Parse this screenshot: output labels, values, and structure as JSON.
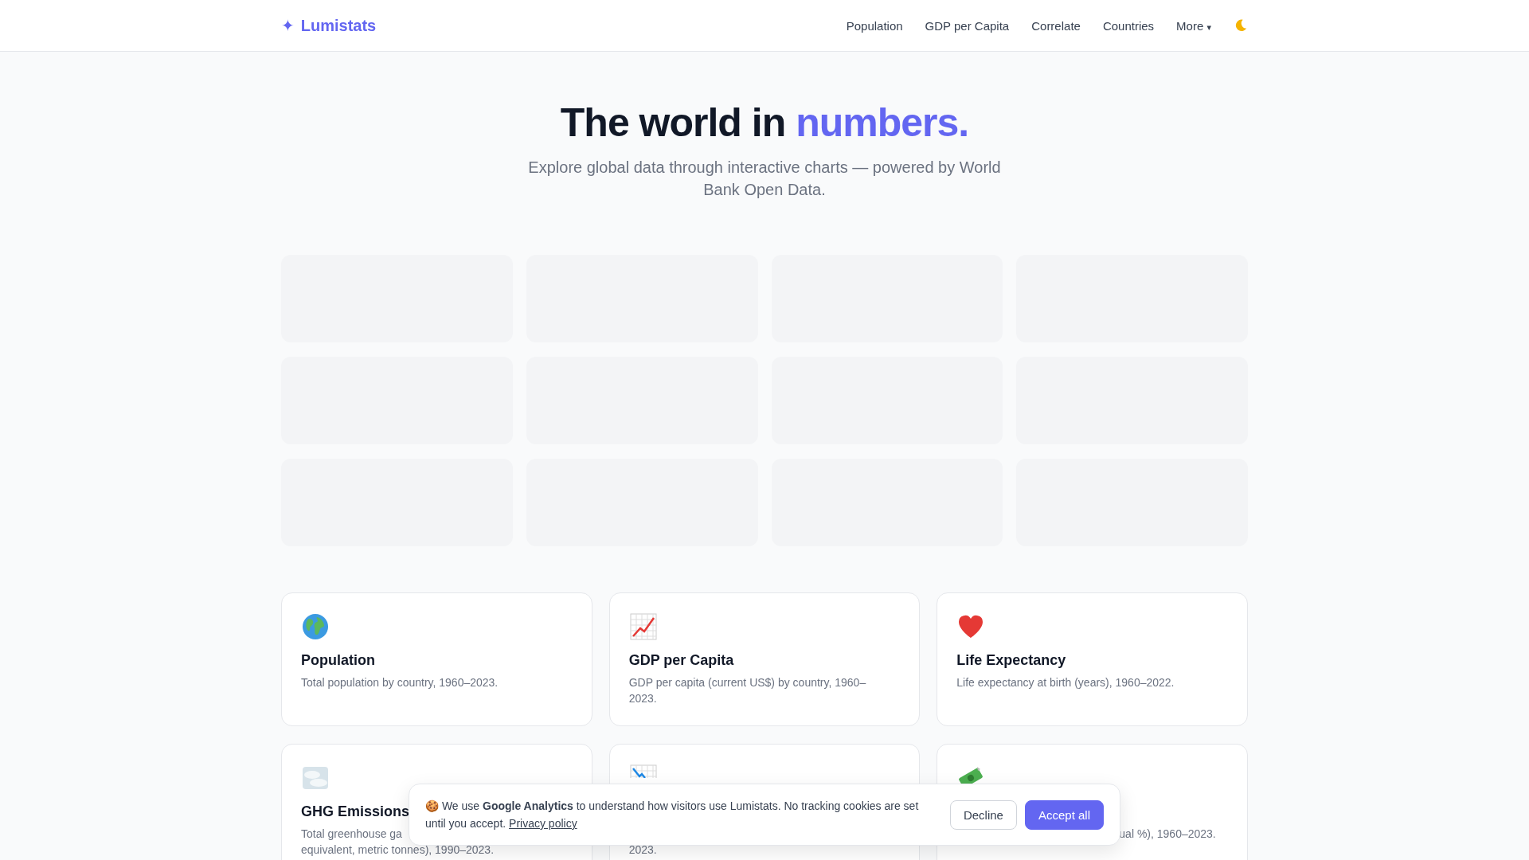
{
  "nav": {
    "logo_mark": "✦",
    "logo_text": "Lumistats",
    "links": [
      {
        "label": "Population"
      },
      {
        "label": "GDP per Capita"
      },
      {
        "label": "Correlate"
      },
      {
        "label": "Countries"
      }
    ],
    "more": {
      "label": "More",
      "caret": "▾"
    }
  },
  "hero": {
    "title": "The world in ",
    "title_accent": "numbers.",
    "subtitle": "Explore global data through interactive charts — powered by World Bank Open Data."
  },
  "stat_placeholders": [
    {
      "kind": "skeleton"
    },
    {
      "kind": "skeleton"
    },
    {
      "kind": "skeleton"
    },
    {
      "kind": "skeleton"
    },
    {
      "kind": "skeleton"
    },
    {
      "kind": "skeleton"
    },
    {
      "kind": "skeleton"
    },
    {
      "kind": "skeleton"
    },
    {
      "kind": "skeleton"
    },
    {
      "kind": "skeleton"
    },
    {
      "kind": "skeleton"
    },
    {
      "kind": "skeleton"
    }
  ],
  "cards": [
    {
      "kind": "globe",
      "title": "Population",
      "lines": [
        {
          "text": "Total population by country, 1960–2023.",
          "kind": "plain"
        }
      ]
    },
    {
      "kind": "chart-up",
      "title": "GDP per Capita",
      "lines": [
        {
          "text": "GDP per capita (current US$) by country, 1960–",
          "kind": "plain"
        },
        {
          "text": "2023.",
          "kind": "plain"
        }
      ]
    },
    {
      "kind": "heart",
      "title": "Life Expectancy",
      "lines": [
        {
          "text": "Life expectancy at birth (years), 1960–2022.",
          "kind": "plain"
        }
      ]
    },
    {
      "kind": "fog",
      "title": "GHG Emissions",
      "lines": [
        {
          "text": "Total greenhouse ga",
          "kind": "plain"
        },
        {
          "text": "equivalent, metric tonnes), 1990–2023.",
          "kind": "plain"
        }
      ]
    },
    {
      "kind": "chart-down",
      "lines": [
        {
          "text": "2023.",
          "kind": "second"
        }
      ]
    },
    {
      "kind": "money",
      "lines": [
        {
          "text": "ual %), 1960–2023.",
          "kind": "tail"
        }
      ]
    }
  ],
  "cookie_banner": {
    "emoji": "🍪",
    "text": "We use **Google Analytics** to understand how visitors use Lumistats. No tracking cookies are set until you accept.",
    "link": "Privacy policy",
    "buttons": [
      {
        "label": "Decline",
        "kind": "secondary"
      },
      {
        "label": "Accept all",
        "kind": "primary"
      }
    ]
  }
}
